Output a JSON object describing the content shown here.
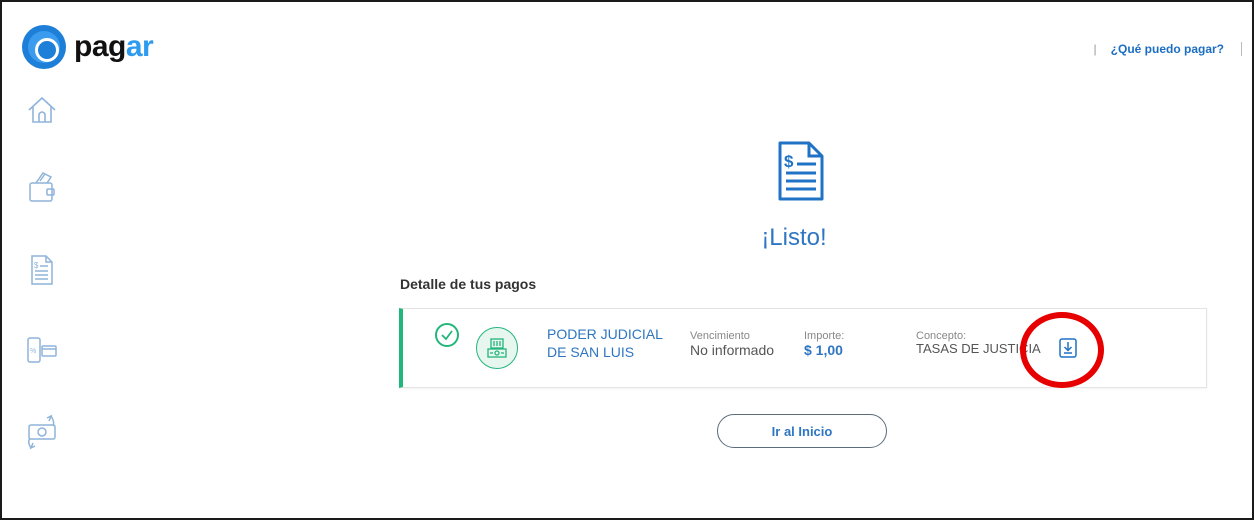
{
  "brand": {
    "name_part1": "pag",
    "name_part2": "ar",
    "accent_color": "#2d9bf0"
  },
  "header": {
    "separator": "|",
    "help_link": "¿Qué puedo pagar?"
  },
  "sidebar": {
    "items": [
      {
        "name": "home-icon"
      },
      {
        "name": "wallet-icon"
      },
      {
        "name": "invoice-icon"
      },
      {
        "name": "mobile-recharge-icon"
      },
      {
        "name": "money-transfer-icon"
      }
    ]
  },
  "main": {
    "status_title": "¡Listo!",
    "section_title": "Detalle de tus pagos",
    "payment": {
      "entity_line1": "PODER JUDICIAL",
      "entity_line2": "DE SAN LUIS",
      "due_label": "Vencimiento",
      "due_value": "No informado",
      "amount_label": "Importe:",
      "amount_value": "$ 1,00",
      "concept_label": "Concepto:",
      "concept_value": "TASAS DE JUSTICIA",
      "status_color": "#23b67a"
    },
    "home_button": "Ir al Inicio"
  }
}
